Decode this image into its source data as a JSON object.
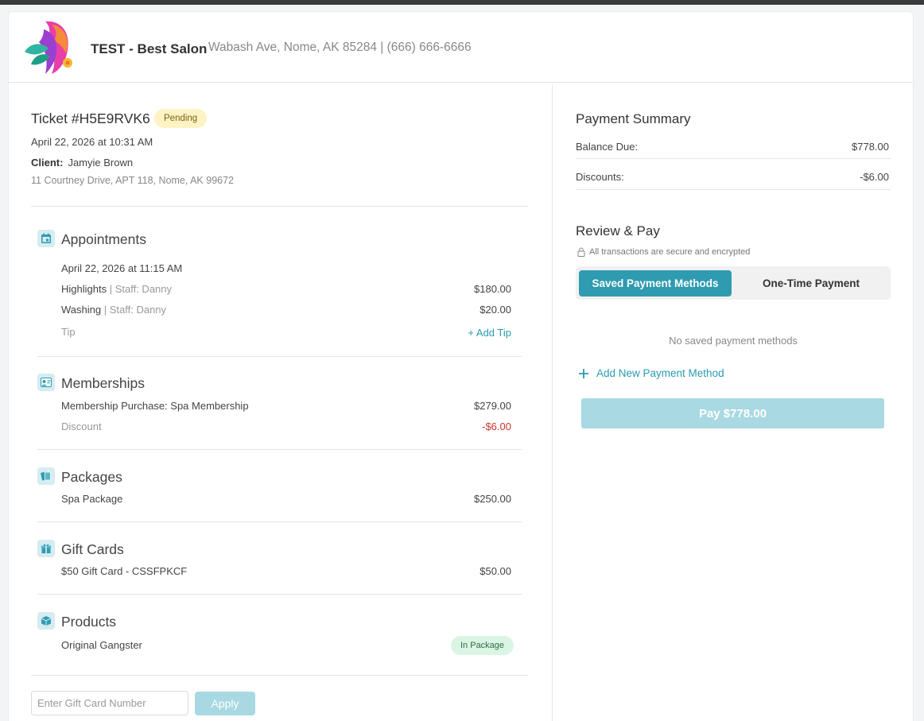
{
  "salon": {
    "name": "TEST - Best Salon",
    "address": "Wabash Ave, Nome, AK 85284 | (666) 666-6666"
  },
  "ticket": {
    "title": "Ticket #H5E9RVK6",
    "status": "Pending",
    "date": "April 22, 2026 at 10:31 AM",
    "client_label": "Client:",
    "client_name": "Jamyie Brown",
    "client_address": "11 Courtney Drive, APT 118, Nome, AK 99672"
  },
  "appointments": {
    "title": "Appointments",
    "date": "April 22, 2026 at 11:15 AM",
    "items": [
      {
        "name": "Highlights",
        "staff": "| Staff: Danny",
        "price": "$180.00"
      },
      {
        "name": "Washing",
        "staff": "| Staff: Danny",
        "price": "$20.00"
      }
    ],
    "tip_label": "Tip",
    "add_tip": "+ Add Tip"
  },
  "memberships": {
    "title": "Memberships",
    "item": {
      "name": "Membership Purchase: Spa Membership",
      "price": "$279.00"
    },
    "discount": {
      "label": "Discount",
      "value": "-$6.00"
    }
  },
  "packages": {
    "title": "Packages",
    "item": {
      "name": "Spa Package",
      "price": "$250.00"
    }
  },
  "gift_cards": {
    "title": "Gift Cards",
    "item": {
      "name": "$50 Gift Card - CSSFPKCF",
      "price": "$50.00"
    }
  },
  "products": {
    "title": "Products",
    "item": {
      "name": "Original Gangster",
      "badge": "In Package"
    }
  },
  "gift_card_form": {
    "placeholder": "Enter Gift Card Number",
    "apply_label": "Apply"
  },
  "summary": {
    "title": "Payment Summary",
    "balance_label": "Balance Due:",
    "balance_value": "$778.00",
    "discounts_label": "Discounts:",
    "discounts_value": "-$6.00"
  },
  "review": {
    "title": "Review & Pay",
    "secure_note": "All transactions are secure and encrypted",
    "tab_saved": "Saved Payment Methods",
    "tab_onetime": "One-Time Payment",
    "empty_text": "No saved payment methods",
    "add_method": "Add New Payment Method",
    "pay_label": "Pay $778.00"
  },
  "colors": {
    "accent": "#2e9bb1",
    "pending_bg": "#fdf3c4",
    "negative": "#c8342e",
    "in_package_bg": "#dbf5e5"
  },
  "icons": {
    "appointments": "calendar-icon",
    "memberships": "member-card-icon",
    "packages": "package-cards-icon",
    "gift_cards": "gift-icon",
    "products": "box-icon",
    "secure": "lock-icon",
    "add": "plus-icon"
  }
}
